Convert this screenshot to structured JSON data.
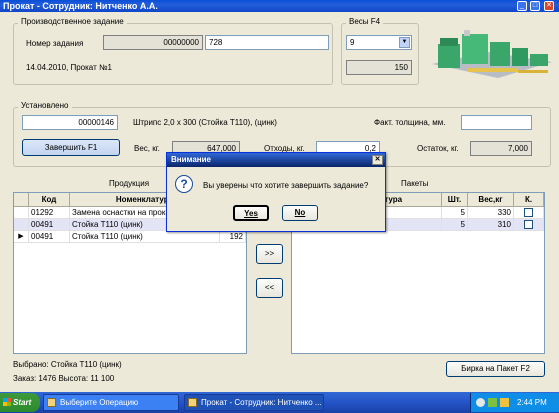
{
  "window": {
    "title": "Прокат - Сотрудник: Нитченко А.А.",
    "min": "_",
    "max": "□",
    "close": "✕"
  },
  "task": {
    "legend": "Производственное задание",
    "number_label": "Номер задания",
    "number_value": "00000000",
    "number_value2": "728",
    "date_text": "14.04.2010, Прокат №1"
  },
  "scales": {
    "legend": "Весы  F4",
    "select_value": "9",
    "value": "150"
  },
  "installed": {
    "legend": "Установлено",
    "code": "00000146",
    "description": "Штрипс 2,0 x 300 (Стойка Т110), (цинк)",
    "thickness_label": "Факт. толщина, мм.",
    "thickness_value": "",
    "finish_button": "Завершить      F1",
    "weight_label": "Вес, кг.",
    "weight_value": "647,000",
    "waste_label": "Отходы, кг.",
    "waste_value": "0,2",
    "remain_label": "Остаток, кг.",
    "remain_value": "7,000"
  },
  "products": {
    "legend": "Продукция",
    "headers": [
      "Код",
      "Номенклатура",
      ""
    ],
    "rows": [
      {
        "code": "01292",
        "name": "Замена оснастки на прока",
        "qty": ""
      },
      {
        "code": "00491",
        "name": "Стойка Т110 (цинк)",
        "qty": "07"
      },
      {
        "code": "00491",
        "name": "Стойка Т110 (цинк)",
        "qty": "192"
      }
    ],
    "selected_label": "Выбрано: Стойка Т110 (цинк)",
    "order_label": "Заказ: 1476  Высота: 11 100"
  },
  "transfer": {
    "right": ">>",
    "left": "<<"
  },
  "packages": {
    "legend": "Пакеты",
    "headers": [
      "",
      "Номенклатура",
      "Шт.",
      "Вес,кг",
      "К."
    ],
    "rows": [
      {
        "name": "Стойка Т110 (цинк)",
        "qty": "5",
        "weight": "330"
      },
      {
        "name": "Стойка Т110 (цинк)",
        "qty": "5",
        "weight": "310"
      }
    ],
    "tag_button": "Бирка на Пакет   F2"
  },
  "dialog": {
    "title": "Внимание",
    "message": "Вы уверены что хотите завершить задание?",
    "yes": "Yes",
    "no": "No"
  },
  "taskbar": {
    "start": "Start",
    "tasks": [
      "Выберите Операцию",
      "Прокат - Сотрудник: Нитченко ..."
    ],
    "clock": "2:44 PM"
  }
}
